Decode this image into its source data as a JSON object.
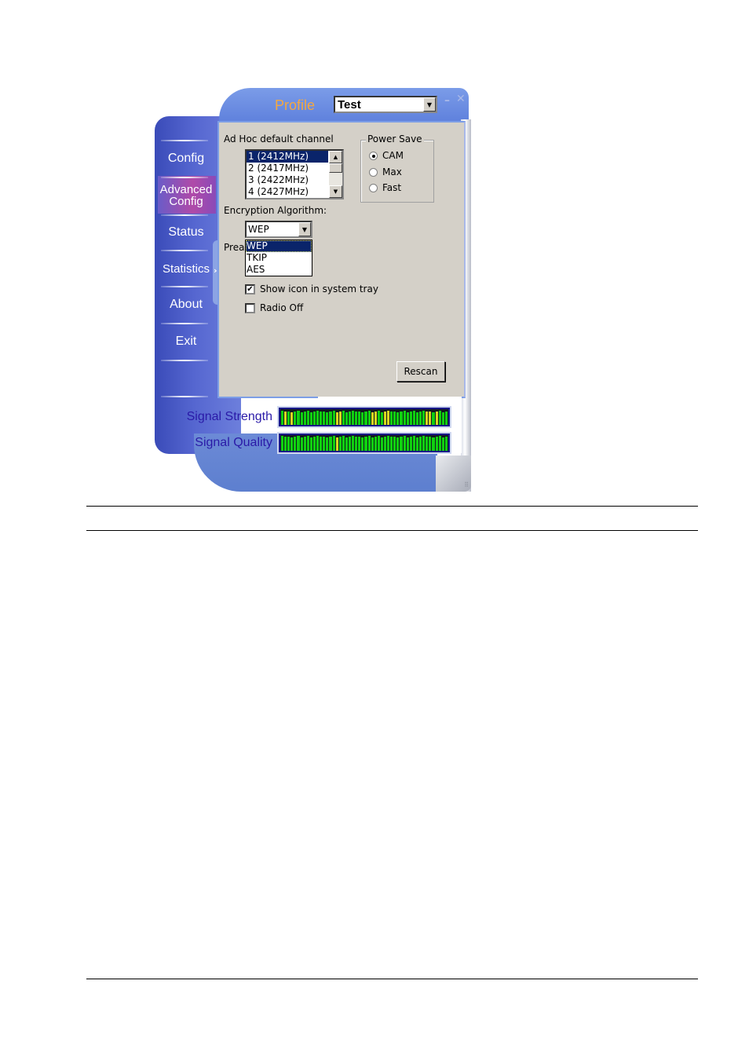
{
  "window": {
    "profile_label": "Profile",
    "profile_value": "Test",
    "minimize_icon": "minimize-icon",
    "close_icon": "close-icon"
  },
  "sidebar": {
    "items": [
      {
        "label": "Config",
        "active": false
      },
      {
        "label": "Advanced Config",
        "active": true
      },
      {
        "label": "Status",
        "active": false
      },
      {
        "label": "Statistics",
        "active": false
      },
      {
        "label": "About",
        "active": false
      },
      {
        "label": "Exit",
        "active": false
      }
    ],
    "collapse_handle_icon": "chevron-right-icon"
  },
  "panel": {
    "adhoc_label": "Ad Hoc default channel",
    "channels": [
      "1  (2412MHz)",
      "2  (2417MHz)",
      "3  (2422MHz)",
      "4  (2427MHz)"
    ],
    "selected_channel": "1  (2412MHz)",
    "power_save": {
      "title": "Power Save",
      "options": [
        "CAM",
        "Max",
        "Fast"
      ],
      "selected": "CAM"
    },
    "encryption_label": "Encryption Algorithm:",
    "encryption_value": "WEP",
    "encryption_options": [
      "WEP",
      "TKIP",
      "AES"
    ],
    "preamble_label_partial": "Prea",
    "show_icon_label": "Show icon in system tray",
    "show_icon_checked": true,
    "radio_off_label": "Radio Off",
    "radio_off_checked": false,
    "rescan_label": "Rescan"
  },
  "meters": {
    "signal_strength_label": "Signal Strength",
    "signal_quality_label": "Signal Quality",
    "signal_strength_level": 0.9,
    "signal_quality_level": 0.95,
    "colors": {
      "green": "#10d010",
      "yellow": "#d8d820",
      "frame": "#1a1a8a"
    }
  }
}
